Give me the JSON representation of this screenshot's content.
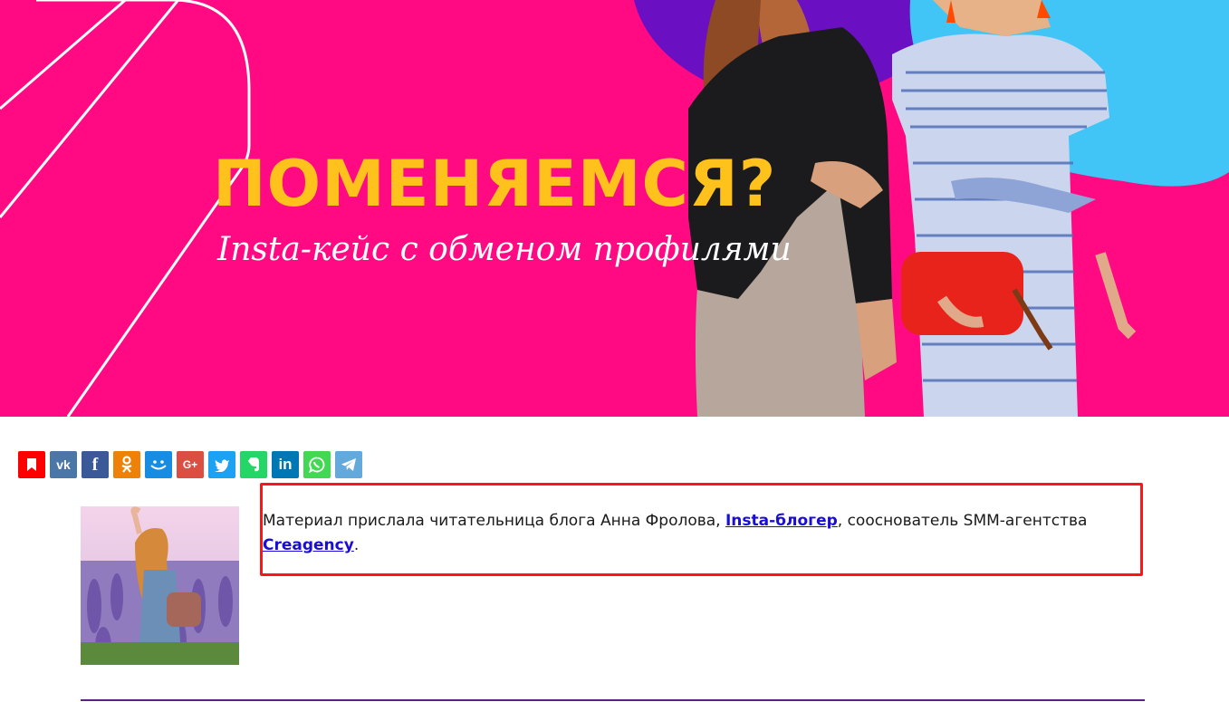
{
  "banner": {
    "title": "ПОМЕНЯЕМСЯ?",
    "subtitle": "Insta-кейс с обменом профилями",
    "background_color": "#ff0a82",
    "title_color": "#ffc21c"
  },
  "share_bar": {
    "buttons": [
      {
        "name": "bookmark",
        "icon": "bookmark-icon",
        "color": "#ff0000"
      },
      {
        "name": "vk",
        "icon": "vk-icon",
        "glyph": "vk",
        "color": "#4a76a8"
      },
      {
        "name": "facebook",
        "icon": "facebook-icon",
        "glyph": "f",
        "color": "#3b5998"
      },
      {
        "name": "odnoklassniki",
        "icon": "odnoklassniki-icon",
        "color": "#ee8208"
      },
      {
        "name": "moimir",
        "icon": "moimir-icon",
        "color": "#168de2"
      },
      {
        "name": "googleplus",
        "icon": "google-plus-icon",
        "glyph": "G+",
        "color": "#dc4e41"
      },
      {
        "name": "twitter",
        "icon": "twitter-icon",
        "color": "#1da1f2"
      },
      {
        "name": "evernote",
        "icon": "evernote-icon",
        "color": "#24d666"
      },
      {
        "name": "linkedin",
        "icon": "linkedin-icon",
        "glyph": "in",
        "color": "#0077b5"
      },
      {
        "name": "whatsapp",
        "icon": "whatsapp-icon",
        "color": "#43d854"
      },
      {
        "name": "telegram",
        "icon": "telegram-icon",
        "color": "#64a9dc"
      }
    ]
  },
  "intro": {
    "text_before": "Материал прислала читательница блога Анна Фролова, ",
    "link1": "Insta-блогер",
    "text_middle": ", сооснователь SMM-агентства ",
    "link2": "Creagency",
    "text_after": ".",
    "highlight_color": "#ff1515",
    "link_color": "#1a0dd6"
  }
}
